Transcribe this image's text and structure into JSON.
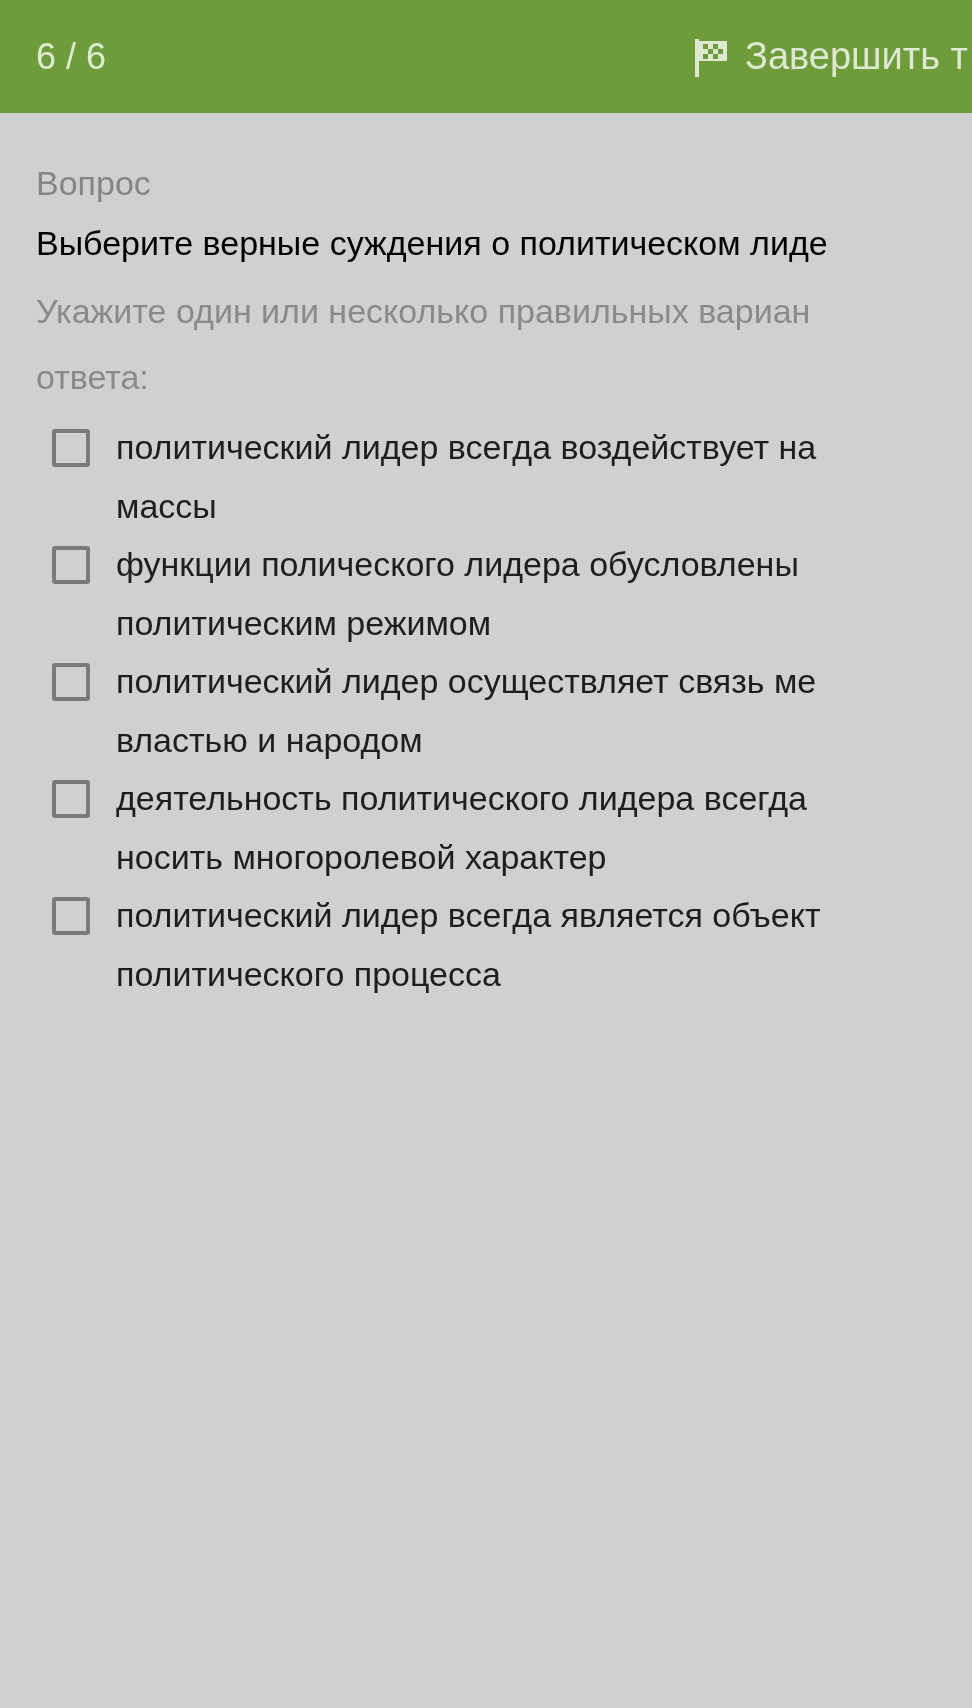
{
  "header": {
    "counter": "6 / 6",
    "finish_button": "Завершить т"
  },
  "question": {
    "label": "Вопрос",
    "text": "Выберите верные суждения о политическом лиде",
    "instruction_lines": [
      "Укажите один или несколько правильных вариан",
      "ответа:"
    ]
  },
  "options": [
    {
      "lines": [
        "политический лидер всегда  воздействует на",
        "массы"
      ],
      "checked": false
    },
    {
      "lines": [
        "функции полического лидера обусловлены",
        "политическим режимом"
      ],
      "checked": false
    },
    {
      "lines": [
        "политический лидер осуществляет связь ме",
        "властью и народом"
      ],
      "checked": false
    },
    {
      "lines": [
        "деятельность политического лидера всегда",
        "носить многоролевой характер"
      ],
      "checked": false
    },
    {
      "lines": [
        "политический лидер всегда является объект",
        "политического процесса"
      ],
      "checked": false
    }
  ]
}
